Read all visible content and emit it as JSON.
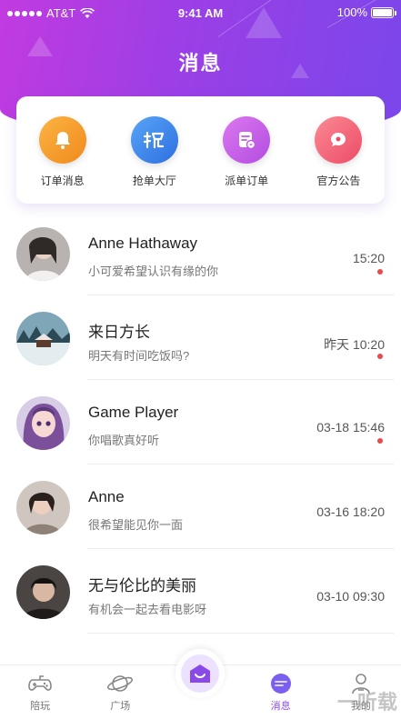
{
  "status_bar": {
    "carrier": "AT&T",
    "time": "9:41 AM",
    "battery": "100%"
  },
  "header": {
    "title": "消息"
  },
  "quick_actions": [
    {
      "label": "订单消息",
      "icon": "bell-icon",
      "color": "#f59a2c"
    },
    {
      "label": "抢单大厅",
      "icon": "grab-order-icon",
      "color": "#3f8ef0"
    },
    {
      "label": "派单订单",
      "icon": "dispatch-order-icon",
      "color": "#c35be8"
    },
    {
      "label": "官方公告",
      "icon": "announcement-icon",
      "color": "#f06277"
    }
  ],
  "conversations": [
    {
      "name": "Anne Hathaway",
      "preview": "小可爱希望认识有缘的你",
      "time": "15:20",
      "unread": true
    },
    {
      "name": "来日方长",
      "preview": "明天有时间吃饭吗?",
      "time": "昨天 10:20",
      "unread": true
    },
    {
      "name": "Game Player",
      "preview": "你唱歌真好听",
      "time": "03-18 15:46",
      "unread": true
    },
    {
      "name": "Anne",
      "preview": "很希望能见你一面",
      "time": "03-16 18:20",
      "unread": false
    },
    {
      "name": "无与伦比的美丽",
      "preview": "有机会一起去看电影呀",
      "time": "03-10 09:30",
      "unread": false
    }
  ],
  "tabbar": {
    "tabs": [
      {
        "label": "陪玩",
        "icon": "gamepad-icon"
      },
      {
        "label": "广场",
        "icon": "planet-icon"
      },
      {
        "label": "消息",
        "icon": "message-icon"
      },
      {
        "label": "我的",
        "icon": "profile-icon"
      }
    ],
    "accent": "#8a4ae8"
  },
  "watermark": "一听载"
}
